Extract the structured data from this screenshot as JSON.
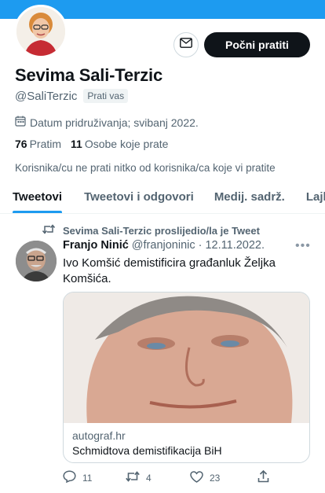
{
  "profile": {
    "name": "Sevima Sali-Terzic",
    "handle": "@SaliTerzic",
    "follows_you": "Prati vas",
    "joined": "Datum pridruživanja; svibanj 2022.",
    "following_count": "76",
    "following_label": "Pratim",
    "followers_count": "11",
    "followers_label": "Osobe koje prate",
    "no_mutual": "Korisnika/cu ne prati nitko od korisnika/ca koje vi pratite"
  },
  "header": {
    "follow_button": "Počni pratiti",
    "accent": "#1d9bf0"
  },
  "tabs": [
    {
      "label": "Tweetovi"
    },
    {
      "label": "Tweetovi i odgovori"
    },
    {
      "label": "Medij. sadrž."
    },
    {
      "label": "Lajkovi"
    }
  ],
  "tweet": {
    "retweeted_by": "Sevima Sali-Terzic proslijedio/la je Tweet",
    "author": "Franjo Ninić",
    "handle_date": "@franjoninic · 12.11.2022.",
    "text": "Ivo Komšić demistificira građanluk Željka Komšića.",
    "card": {
      "domain": "autograf.hr",
      "title": "Schmidtova demistifikacija BiH"
    },
    "replies": "11",
    "retweets": "4",
    "likes": "23"
  },
  "icons": [
    "mail-icon",
    "calendar-icon",
    "retweet-icon",
    "more-icon",
    "reply-icon",
    "like-icon",
    "share-icon"
  ]
}
